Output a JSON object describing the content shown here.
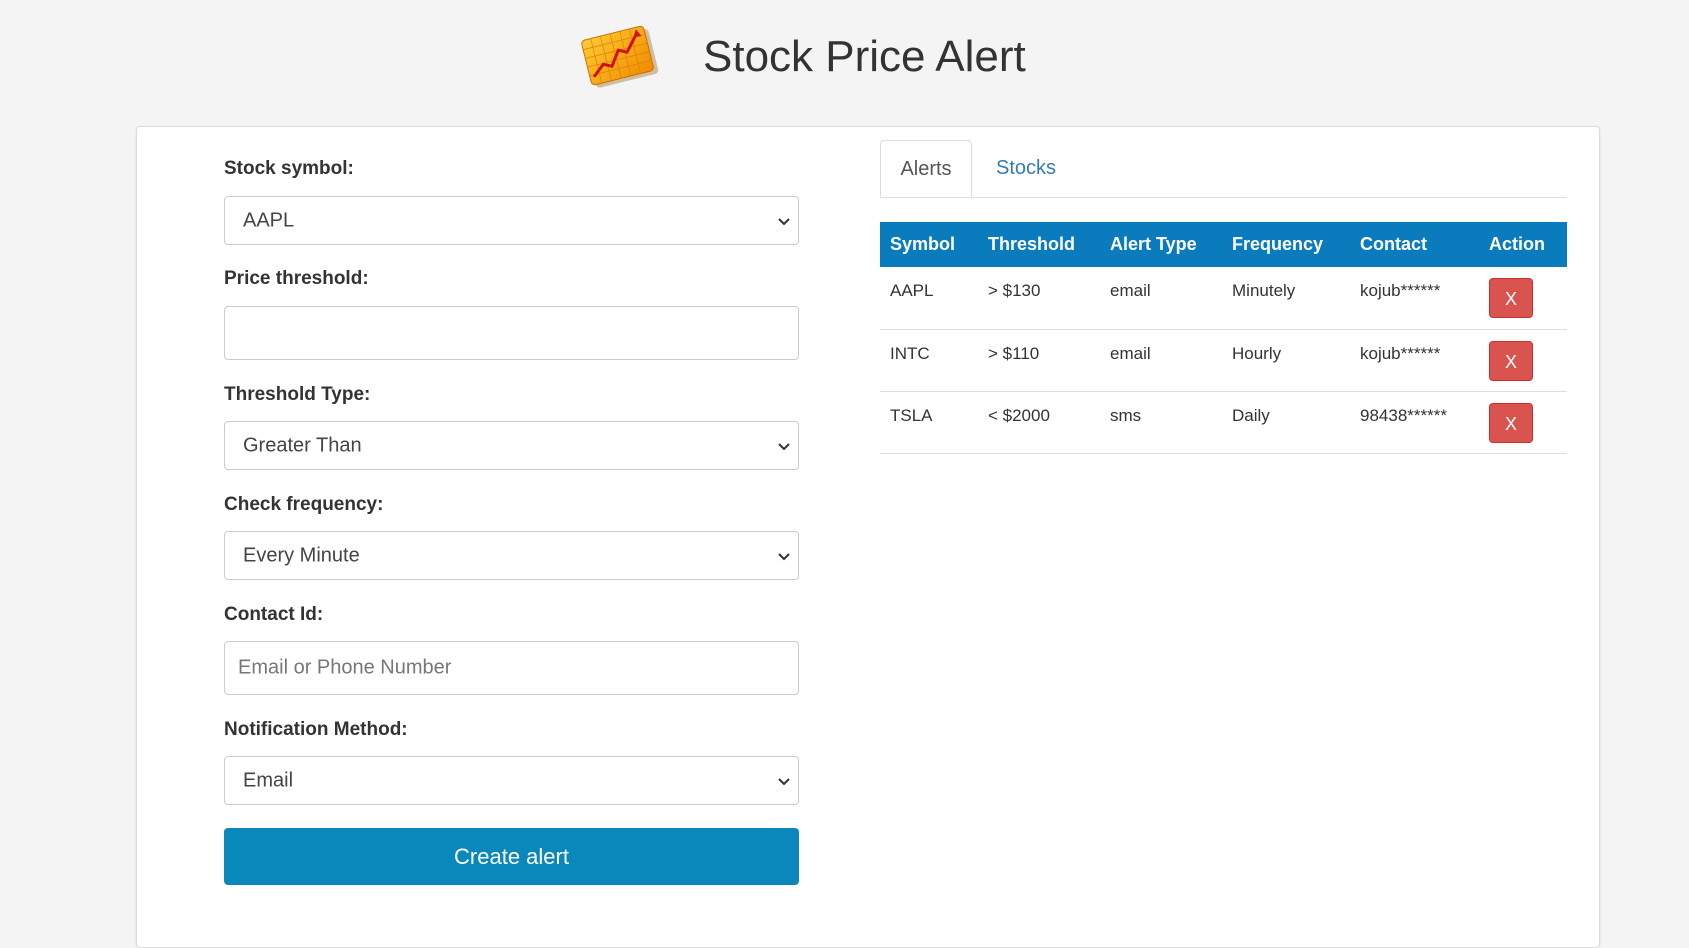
{
  "header": {
    "title": "Stock Price Alert",
    "logo_icon": "stock-chart-logo-icon"
  },
  "form": {
    "stock_symbol_label": "Stock symbol:",
    "stock_symbol_value": "AAPL",
    "price_threshold_label": "Price threshold:",
    "price_threshold_value": "",
    "threshold_type_label": "Threshold Type:",
    "threshold_type_value": "Greater Than",
    "check_frequency_label": "Check frequency:",
    "check_frequency_value": "Every Minute",
    "contact_id_label": "Contact Id:",
    "contact_id_placeholder": "Email or Phone Number",
    "notification_method_label": "Notification Method:",
    "notification_method_value": "Email",
    "create_button_label": "Create alert"
  },
  "tabs": [
    {
      "label": "Alerts",
      "active": true
    },
    {
      "label": "Stocks",
      "active": false
    }
  ],
  "table": {
    "headers": [
      "Symbol",
      "Threshold",
      "Alert Type",
      "Frequency",
      "Contact",
      "Action"
    ],
    "rows": [
      {
        "symbol": "AAPL",
        "threshold": "> $130",
        "alert_type": "email",
        "frequency": "Minutely",
        "contact": "kojub******",
        "action": "X"
      },
      {
        "symbol": "INTC",
        "threshold": "> $110",
        "alert_type": "email",
        "frequency": "Hourly",
        "contact": "kojub******",
        "action": "X"
      },
      {
        "symbol": "TSLA",
        "threshold": "< $2000",
        "alert_type": "sms",
        "frequency": "Daily",
        "contact": "98438******",
        "action": "X"
      }
    ]
  },
  "colors": {
    "primary_button": "#0a88bb",
    "table_header": "#0a7bbd",
    "delete_button": "#d9534f",
    "tab_link": "#337ab7"
  }
}
